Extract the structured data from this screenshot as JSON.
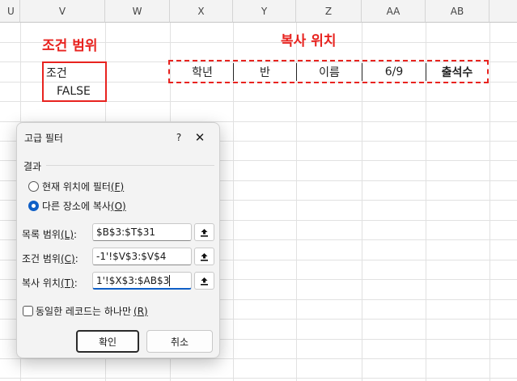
{
  "columns": [
    "U",
    "V",
    "W",
    "X",
    "Y",
    "Z",
    "AA",
    "AB"
  ],
  "criteria_title": "조건 범위",
  "copy_title": "복사 위치",
  "criteria": {
    "header": "조건",
    "value": "FALSE"
  },
  "copy_headers": [
    "학년",
    "반",
    "이름",
    "6/9",
    "출석수"
  ],
  "dialog": {
    "title": "고급 필터",
    "help": "?",
    "close": "✕",
    "result_label": "결과",
    "radio_filter_in_place": {
      "text": "현재 위치에 필터",
      "key": "(F)"
    },
    "radio_copy_to": {
      "text": "다른 장소에 복사",
      "key": "(O)"
    },
    "list_range": {
      "text": "목록 범위",
      "key": "(L)",
      "suffix": ":",
      "value": "$B$3:$T$31"
    },
    "criteria_range": {
      "text": "조건 범위",
      "key": "(C)",
      "suffix": ":",
      "value": "-1'!$V$3:$V$4"
    },
    "copy_to": {
      "text": "복사 위치",
      "key": "(T)",
      "suffix": ":",
      "value": "1'!$X$3:$AB$3"
    },
    "unique_records": {
      "text": "동일한 레코드는 하나만",
      "key": "(R)"
    },
    "ok": "확인",
    "cancel": "취소"
  },
  "colors": {
    "annotation_red": "#e8231f",
    "accent_blue": "#0f5fc6"
  },
  "icons": {
    "collapse": "collapse-dialog-icon"
  }
}
